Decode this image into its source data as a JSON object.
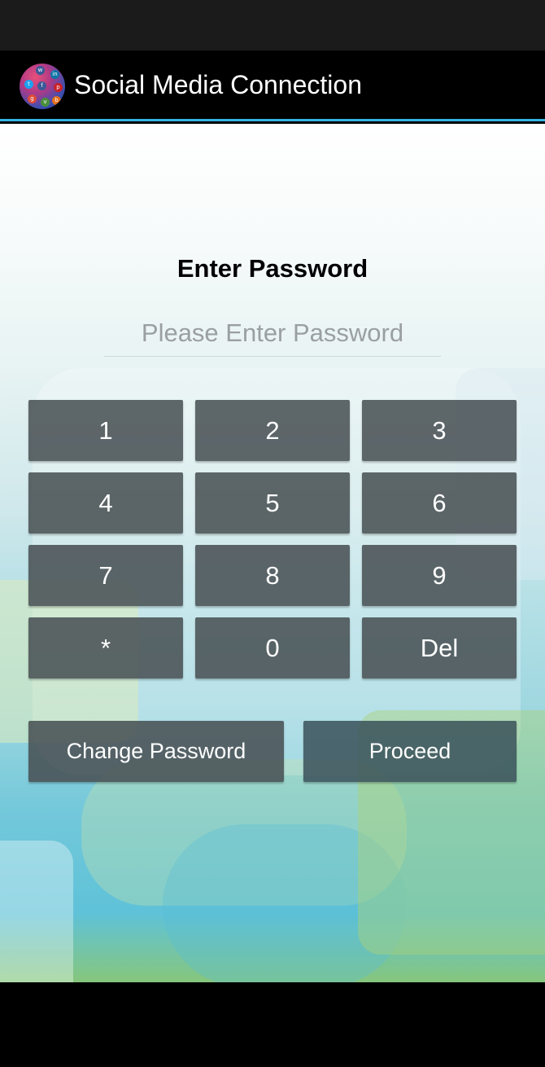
{
  "app": {
    "title": "Social Media Connection",
    "icon": "social-media-globe-icon"
  },
  "form": {
    "heading": "Enter Password",
    "password_value": "",
    "password_placeholder": "Please Enter Password"
  },
  "keypad": {
    "keys": [
      "1",
      "2",
      "3",
      "4",
      "5",
      "6",
      "7",
      "8",
      "9",
      "*",
      "0",
      "Del"
    ]
  },
  "actions": {
    "change_password_label": "Change Password",
    "proceed_label": "Proceed"
  },
  "colors": {
    "accent": "#33b5e5",
    "key_background": "#464e52",
    "action_bar": "#000000"
  }
}
